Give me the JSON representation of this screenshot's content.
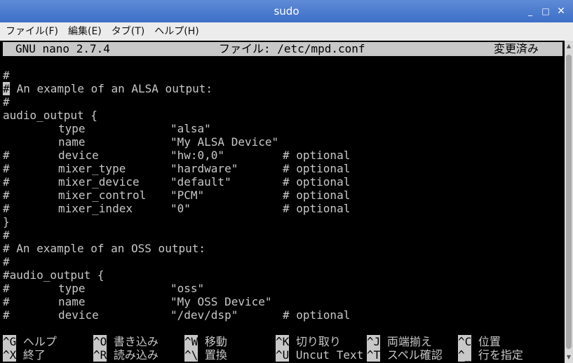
{
  "window": {
    "title": "sudo",
    "minimize": "_",
    "maximize": "□",
    "close": "✕"
  },
  "menu": [
    {
      "label": "ファイル(F)"
    },
    {
      "label": "編集(E)"
    },
    {
      "label": "タブ(T)"
    },
    {
      "label": "ヘルプ(H)"
    }
  ],
  "nano": {
    "version": "GNU nano 2.7.4",
    "file": "ファイル: /etc/mpd.conf",
    "status": "変更済み"
  },
  "lines": [
    {
      "p": "#"
    },
    {
      "p": "#",
      "cursor": true,
      "a": " An example of an ALSA output:"
    },
    {
      "p": "#"
    },
    {
      "p": "audio_output {"
    },
    {
      "p": "",
      "k": "type",
      "v": "\"alsa\""
    },
    {
      "p": "",
      "k": "name",
      "v": "\"My ALSA Device\""
    },
    {
      "p": "#",
      "k": "device",
      "v": "\"hw:0,0\"",
      "c": "# optional"
    },
    {
      "p": "#",
      "k": "mixer_type",
      "v": "\"hardware\"",
      "c": "# optional"
    },
    {
      "p": "#",
      "k": "mixer_device",
      "v": "\"default\"",
      "c": "# optional"
    },
    {
      "p": "#",
      "k": "mixer_control",
      "v": "\"PCM\"",
      "c": "# optional"
    },
    {
      "p": "#",
      "k": "mixer_index",
      "v": "\"0\"",
      "c": "# optional"
    },
    {
      "p": "}"
    },
    {
      "p": "#"
    },
    {
      "p": "# An example of an OSS output:"
    },
    {
      "p": "#"
    },
    {
      "p": "#audio_output {"
    },
    {
      "p": "#",
      "k": "type",
      "v": "\"oss\""
    },
    {
      "p": "#",
      "k": "name",
      "v": "\"My OSS Device\""
    },
    {
      "p": "#",
      "k": "device",
      "v": "\"/dev/dsp\"",
      "c": "# optional"
    }
  ],
  "shortcuts": [
    [
      {
        "key": "^G",
        "label": " ヘルプ"
      },
      {
        "key": "^O",
        "label": " 書き込み"
      },
      {
        "key": "^W",
        "label": " 移動"
      },
      {
        "key": "^K",
        "label": " 切り取り"
      },
      {
        "key": "^J",
        "label": " 両端揃え"
      },
      {
        "key": "^C",
        "label": " 位置"
      }
    ],
    [
      {
        "key": "^X",
        "label": " 終了"
      },
      {
        "key": "^R",
        "label": " 読み込み"
      },
      {
        "key": "^\\",
        "label": " 置換"
      },
      {
        "key": "^U",
        "label": " Uncut Text"
      },
      {
        "key": "^T",
        "label": " スペル確認"
      },
      {
        "key": "^_",
        "label": " 行を指定"
      }
    ]
  ]
}
